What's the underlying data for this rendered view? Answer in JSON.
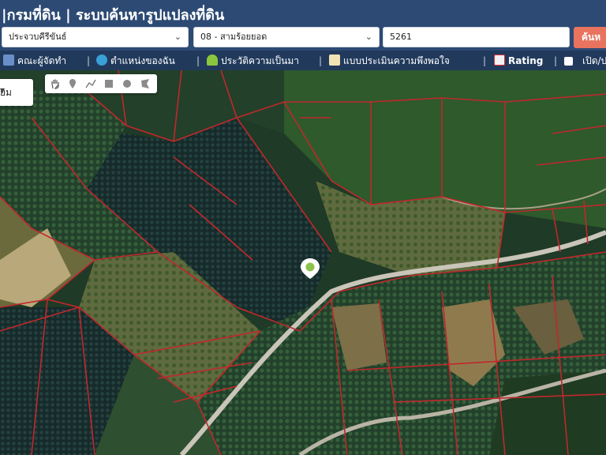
{
  "header": {
    "title": "|กรมที่ดิน | ระบบค้นหารูปแปลงที่ดิน"
  },
  "search": {
    "province": "ประจวบคีรีขันธ์",
    "district": "08 - สามร้อยยอด",
    "parcel_no": "5261",
    "search_label": "ค้นห"
  },
  "menu": {
    "items": [
      {
        "label": "คณะผู้จัดทำ",
        "icon": "team-icon"
      },
      {
        "label": "ตำแหน่งของฉัน",
        "icon": "globe-icon"
      },
      {
        "label": "ประวัติความเป็นมา",
        "icon": "sprout-icon"
      },
      {
        "label": "แบบประเมินความพึงพอใจ",
        "icon": "document-icon"
      },
      {
        "label": "Rating",
        "icon": "chart-icon"
      },
      {
        "label": "เปิด/ป",
        "icon": "checkbox-icon"
      }
    ]
  },
  "map": {
    "basemap_label": "ยม",
    "parcel_line_color": "#c0282c",
    "marker_color": "#8bc34a"
  },
  "tools": [
    "hand-icon",
    "pin-icon",
    "line-icon",
    "square-icon",
    "circle-icon",
    "polygon-icon"
  ]
}
